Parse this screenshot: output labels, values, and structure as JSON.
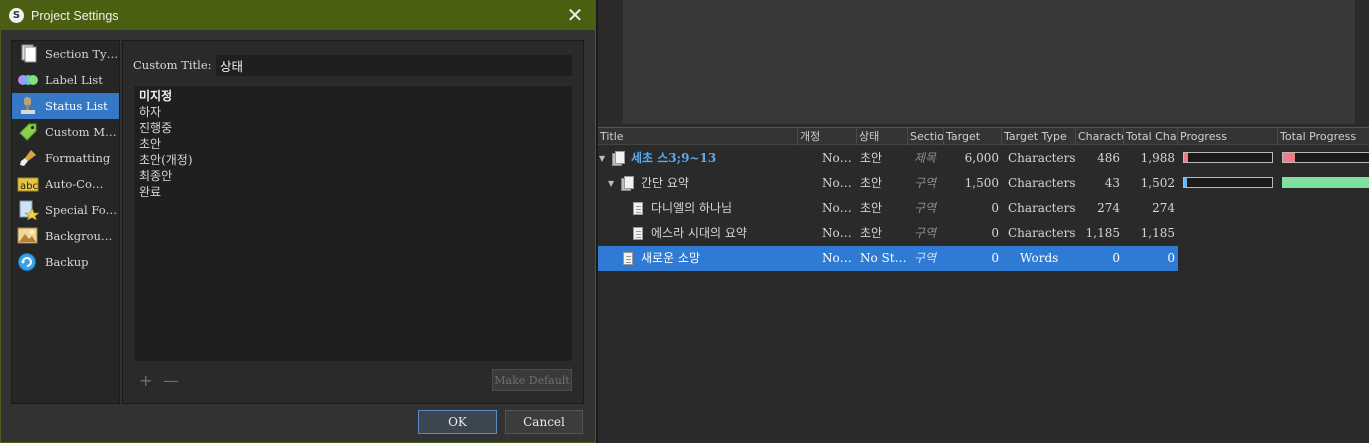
{
  "dialog": {
    "title": "Project Settings",
    "app_icon": "S",
    "close_glyph": "✕",
    "sidebar": [
      {
        "label": "Section Ty…",
        "icon": "section-types-icon"
      },
      {
        "label": "Label List",
        "icon": "label-list-icon"
      },
      {
        "label": "Status List",
        "icon": "status-list-icon",
        "active": true
      },
      {
        "label": "Custom M…",
        "icon": "custom-metadata-icon"
      },
      {
        "label": "Formatting",
        "icon": "formatting-icon"
      },
      {
        "label": "Auto-Co…",
        "icon": "auto-complete-icon"
      },
      {
        "label": "Special Fol…",
        "icon": "special-folders-icon"
      },
      {
        "label": "Backgroun…",
        "icon": "backgrounds-icon"
      },
      {
        "label": "Backup",
        "icon": "backup-icon"
      }
    ],
    "custom_title_label": "Custom Title:",
    "custom_title_value": "상태",
    "status_items": [
      {
        "label": "미지정",
        "bold": true
      },
      {
        "label": "하자"
      },
      {
        "label": "진행중"
      },
      {
        "label": "초안"
      },
      {
        "label": "초안(개정)"
      },
      {
        "label": "최종안"
      },
      {
        "label": "완료"
      }
    ],
    "add_glyph": "+",
    "remove_glyph": "—",
    "make_default_label": "Make Default",
    "ok_label": "OK",
    "cancel_label": "Cancel"
  },
  "outline": {
    "columns": [
      "Title",
      "개정",
      "상태",
      "Section",
      "Target",
      "Target Type",
      "Characters",
      "Total Characters",
      "Progress",
      "Total Progress"
    ],
    "colors": {
      "progress_red": "#f07b8a",
      "progress_green": "#7fe0a0",
      "progress_blue": "#6ab8f0",
      "selected": "#2f7bd4"
    },
    "rows": [
      {
        "title": "세초 스3;9~13",
        "revision": "No…",
        "status": "초안",
        "section": "제목",
        "target": "6,000",
        "target_type": "Characters",
        "chars": "486",
        "total_chars": "1,988",
        "progress": 0.04,
        "total_progress": 0.14,
        "indent": 0,
        "expanded": true,
        "icon": "folder-document-icon",
        "highlight": true
      },
      {
        "title": "간단 요약",
        "revision": "No…",
        "status": "초안",
        "section": "구역",
        "target": "1,500",
        "target_type": "Characters",
        "chars": "43",
        "total_chars": "1,502",
        "progress": 0.03,
        "total_progress": 1.0,
        "indent": 1,
        "expanded": true,
        "icon": "folder-document-icon"
      },
      {
        "title": "다니엘의 하나님",
        "revision": "No…",
        "status": "초안",
        "section": "구역",
        "target": "0",
        "target_type": "Characters",
        "chars": "274",
        "total_chars": "274",
        "indent": 2,
        "icon": "document-icon"
      },
      {
        "title": "에스라 시대의 요약",
        "revision": "No…",
        "status": "초안",
        "section": "구역",
        "target": "0",
        "target_type": "Characters",
        "chars": "1,185",
        "total_chars": "1,185",
        "indent": 2,
        "icon": "document-icon"
      },
      {
        "title": "새로운 소망",
        "revision": "No…",
        "status": "No St…",
        "section": "구역",
        "target": "0",
        "target_type": "Words",
        "chars": "0",
        "total_chars": "0",
        "indent": 1,
        "icon": "document-icon",
        "selected": true
      }
    ]
  }
}
